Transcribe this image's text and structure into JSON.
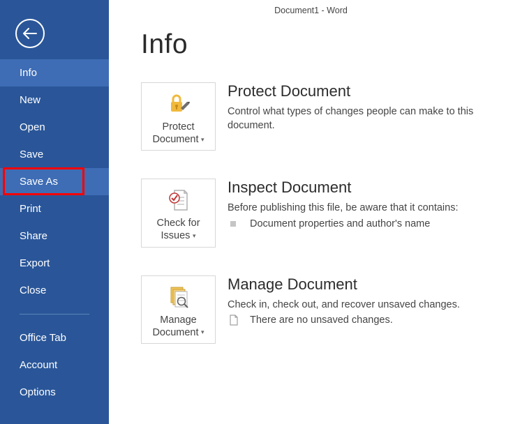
{
  "window_title": "Document1 - Word",
  "page_heading": "Info",
  "sidebar": {
    "items": [
      {
        "label": "Info"
      },
      {
        "label": "New"
      },
      {
        "label": "Open"
      },
      {
        "label": "Save"
      },
      {
        "label": "Save As"
      },
      {
        "label": "Print"
      },
      {
        "label": "Share"
      },
      {
        "label": "Export"
      },
      {
        "label": "Close"
      }
    ],
    "bottom_items": [
      {
        "label": "Office Tab"
      },
      {
        "label": "Account"
      },
      {
        "label": "Options"
      }
    ]
  },
  "sections": {
    "protect": {
      "tile_line1": "Protect",
      "tile_line2": "Document",
      "heading": "Protect Document",
      "desc": "Control what types of changes people can make to this document."
    },
    "inspect": {
      "tile_line1": "Check for",
      "tile_line2": "Issues",
      "heading": "Inspect Document",
      "desc": "Before publishing this file, be aware that it contains:",
      "bullet1": "Document properties and author's name"
    },
    "manage": {
      "tile_line1": "Manage",
      "tile_line2": "Document",
      "heading": "Manage Document",
      "desc": "Check in, check out, and recover unsaved changes.",
      "bullet1": "There are no unsaved changes."
    }
  }
}
